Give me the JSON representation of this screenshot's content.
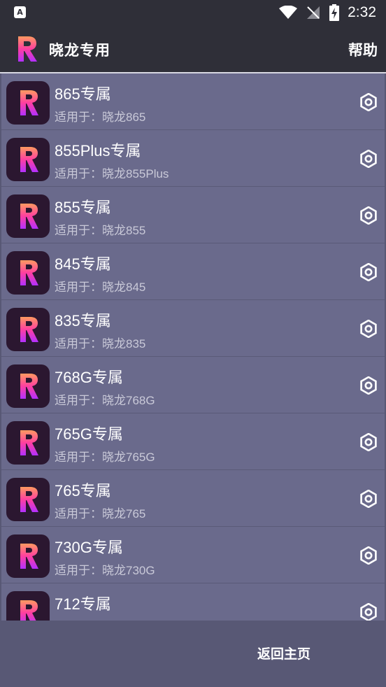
{
  "status_bar": {
    "time": "2:32",
    "app_badge": "A"
  },
  "header": {
    "title": "晓龙专用",
    "help_label": "帮助"
  },
  "items": [
    {
      "title": "865专属",
      "subtitle": "适用于：晓龙865"
    },
    {
      "title": "855Plus专属",
      "subtitle": "适用于：晓龙855Plus"
    },
    {
      "title": "855专属",
      "subtitle": "适用于：晓龙855"
    },
    {
      "title": "845专属",
      "subtitle": "适用于：晓龙845"
    },
    {
      "title": "835专属",
      "subtitle": "适用于：晓龙835"
    },
    {
      "title": "768G专属",
      "subtitle": "适用于：晓龙768G"
    },
    {
      "title": "765G专属",
      "subtitle": "适用于：晓龙765G"
    },
    {
      "title": "765专属",
      "subtitle": "适用于：晓龙765"
    },
    {
      "title": "730G专属",
      "subtitle": "适用于：晓龙730G"
    },
    {
      "title": "712专属",
      "subtitle": ""
    }
  ],
  "footer": {
    "home_label": "返回主页"
  },
  "colors": {
    "bar": "#2f2f38",
    "list_bg": "#6a6a8c",
    "page_bg": "#585875",
    "icon_bg": "#2b1730"
  }
}
